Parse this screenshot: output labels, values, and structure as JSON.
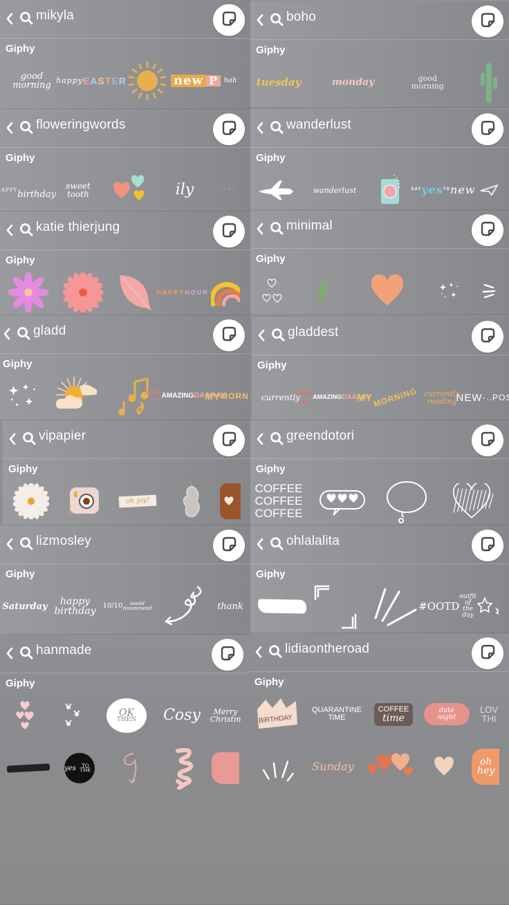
{
  "source_label": "Giphy",
  "colors": {
    "background": "#8e8f93",
    "text": "#ffffff",
    "sticker_button_bg": "#ffffff",
    "sticker_icon": "#4a4a4a"
  },
  "icons": {
    "back": "chevron-left-icon",
    "search": "search-icon",
    "sticker": "sticker-icon"
  },
  "panels": [
    {
      "query": "mikyla",
      "stickers": [
        "good morning",
        "happy EASTER",
        "sun",
        "new P",
        "hah"
      ]
    },
    {
      "query": "boho",
      "stickers": [
        "tuesday",
        "monday",
        "good morning",
        "cactus"
      ]
    },
    {
      "query": "floweringwords",
      "stickers": [
        "HAPPY birthday",
        "sweet tooth",
        "hearts",
        "ily",
        "dots"
      ]
    },
    {
      "query": "wanderlust",
      "stickers": [
        "airplane",
        "wanderlust",
        "passport",
        "SAY yes TO new adventures",
        "paper plane"
      ]
    },
    {
      "query": "katie thierjung",
      "stickers": [
        "purple flower",
        "pink daisy",
        "leaf",
        "HAPPY HOUR",
        "rainbow"
      ]
    },
    {
      "query": "minimal",
      "stickers": [
        "hearts doodle",
        "leaf",
        "heart",
        "sparkles",
        "lines"
      ]
    },
    {
      "query": "gladd",
      "stickers": [
        "sparkles",
        "sun cloud",
        "music notes",
        "have an AMAZING DAAAAY",
        "MY MORN"
      ]
    },
    {
      "query": "gladdest",
      "stickers": [
        "currently",
        "have an AMAZING DAAAAY",
        "MY MORNING",
        "currently reading",
        "NEW POS"
      ]
    },
    {
      "query": "vipapier",
      "stickers": [
        "daisy",
        "instant camera",
        "oh joy!",
        "butterfly",
        "heart bubble"
      ]
    },
    {
      "query": "greendotori",
      "stickers": [
        "COFFEE COFFEE COFFEE",
        "hearts bubble",
        "thought bubble",
        "scribble heart"
      ]
    },
    {
      "query": "lizmosley",
      "stickers": [
        "Saturday",
        "happy birthday",
        "10/10 would recommend",
        "swirl arrow",
        "thank"
      ]
    },
    {
      "query": "ohlalalita",
      "stickers": [
        "brush stroke",
        "frame corners",
        "burst lines",
        "#OOTD outfit of the day",
        "stars"
      ]
    },
    {
      "query": "hanmade",
      "stickers": [
        "hearts",
        "paw prints",
        "OK THEN",
        "Cosy",
        "Merry Christmas",
        "scribble",
        "yes to the",
        "loop arrow",
        "swirl arrow",
        "pink lettering"
      ]
    },
    {
      "query": "lidiaontheroad",
      "stickers": [
        "BIRTHDAY",
        "QUARANTINE TIME",
        "COFFEE time",
        "date night",
        "LOVE THIS",
        "burst lines",
        "Sunday",
        "hearts",
        "heart",
        "oh hey"
      ]
    }
  ]
}
